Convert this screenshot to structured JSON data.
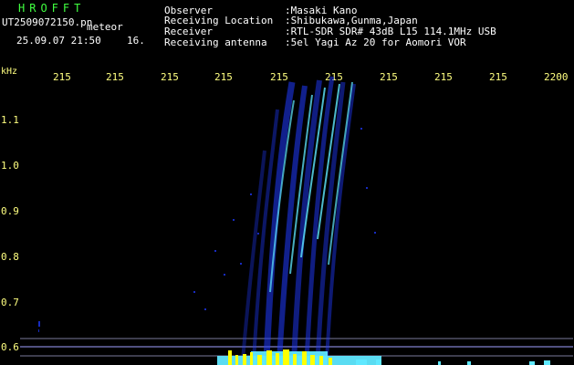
{
  "header": {
    "app_title": "HROFFT",
    "filename": "UT2509072150.pn",
    "mode": "meteor",
    "datetime": "25.09.07 21:50",
    "counter": "16."
  },
  "info": {
    "rows": [
      {
        "key": "Observer",
        "value": ":Masaki Kano"
      },
      {
        "key": "Receiving Location",
        "value": ":Shibukawa,Gunma,Japan"
      },
      {
        "key": "Receiver",
        "value": ":RTL-SDR SDR# 43dB L15 114.1MHz USB"
      },
      {
        "key": "Receiving antenna",
        "value": ":5el Yagi Az 20 for Aomori VOR"
      }
    ]
  },
  "axes": {
    "unit_label": "kHz",
    "x_labels": [
      "215",
      "215",
      "215",
      "215",
      "215",
      "215",
      "215",
      "215",
      "215",
      "2200"
    ],
    "y_labels": [
      "1.1",
      "1.0",
      "0.9",
      "0.8",
      "0.7",
      "0.6"
    ]
  },
  "colors": {
    "background": "#000000",
    "title_green": "#40ff40",
    "axis_text": "#ffff80",
    "gridline": "#a0a0ff",
    "signal_blue": "#1f3aff",
    "signal_cyan": "#5fe8ff",
    "power_yellow": "#ffff00"
  }
}
